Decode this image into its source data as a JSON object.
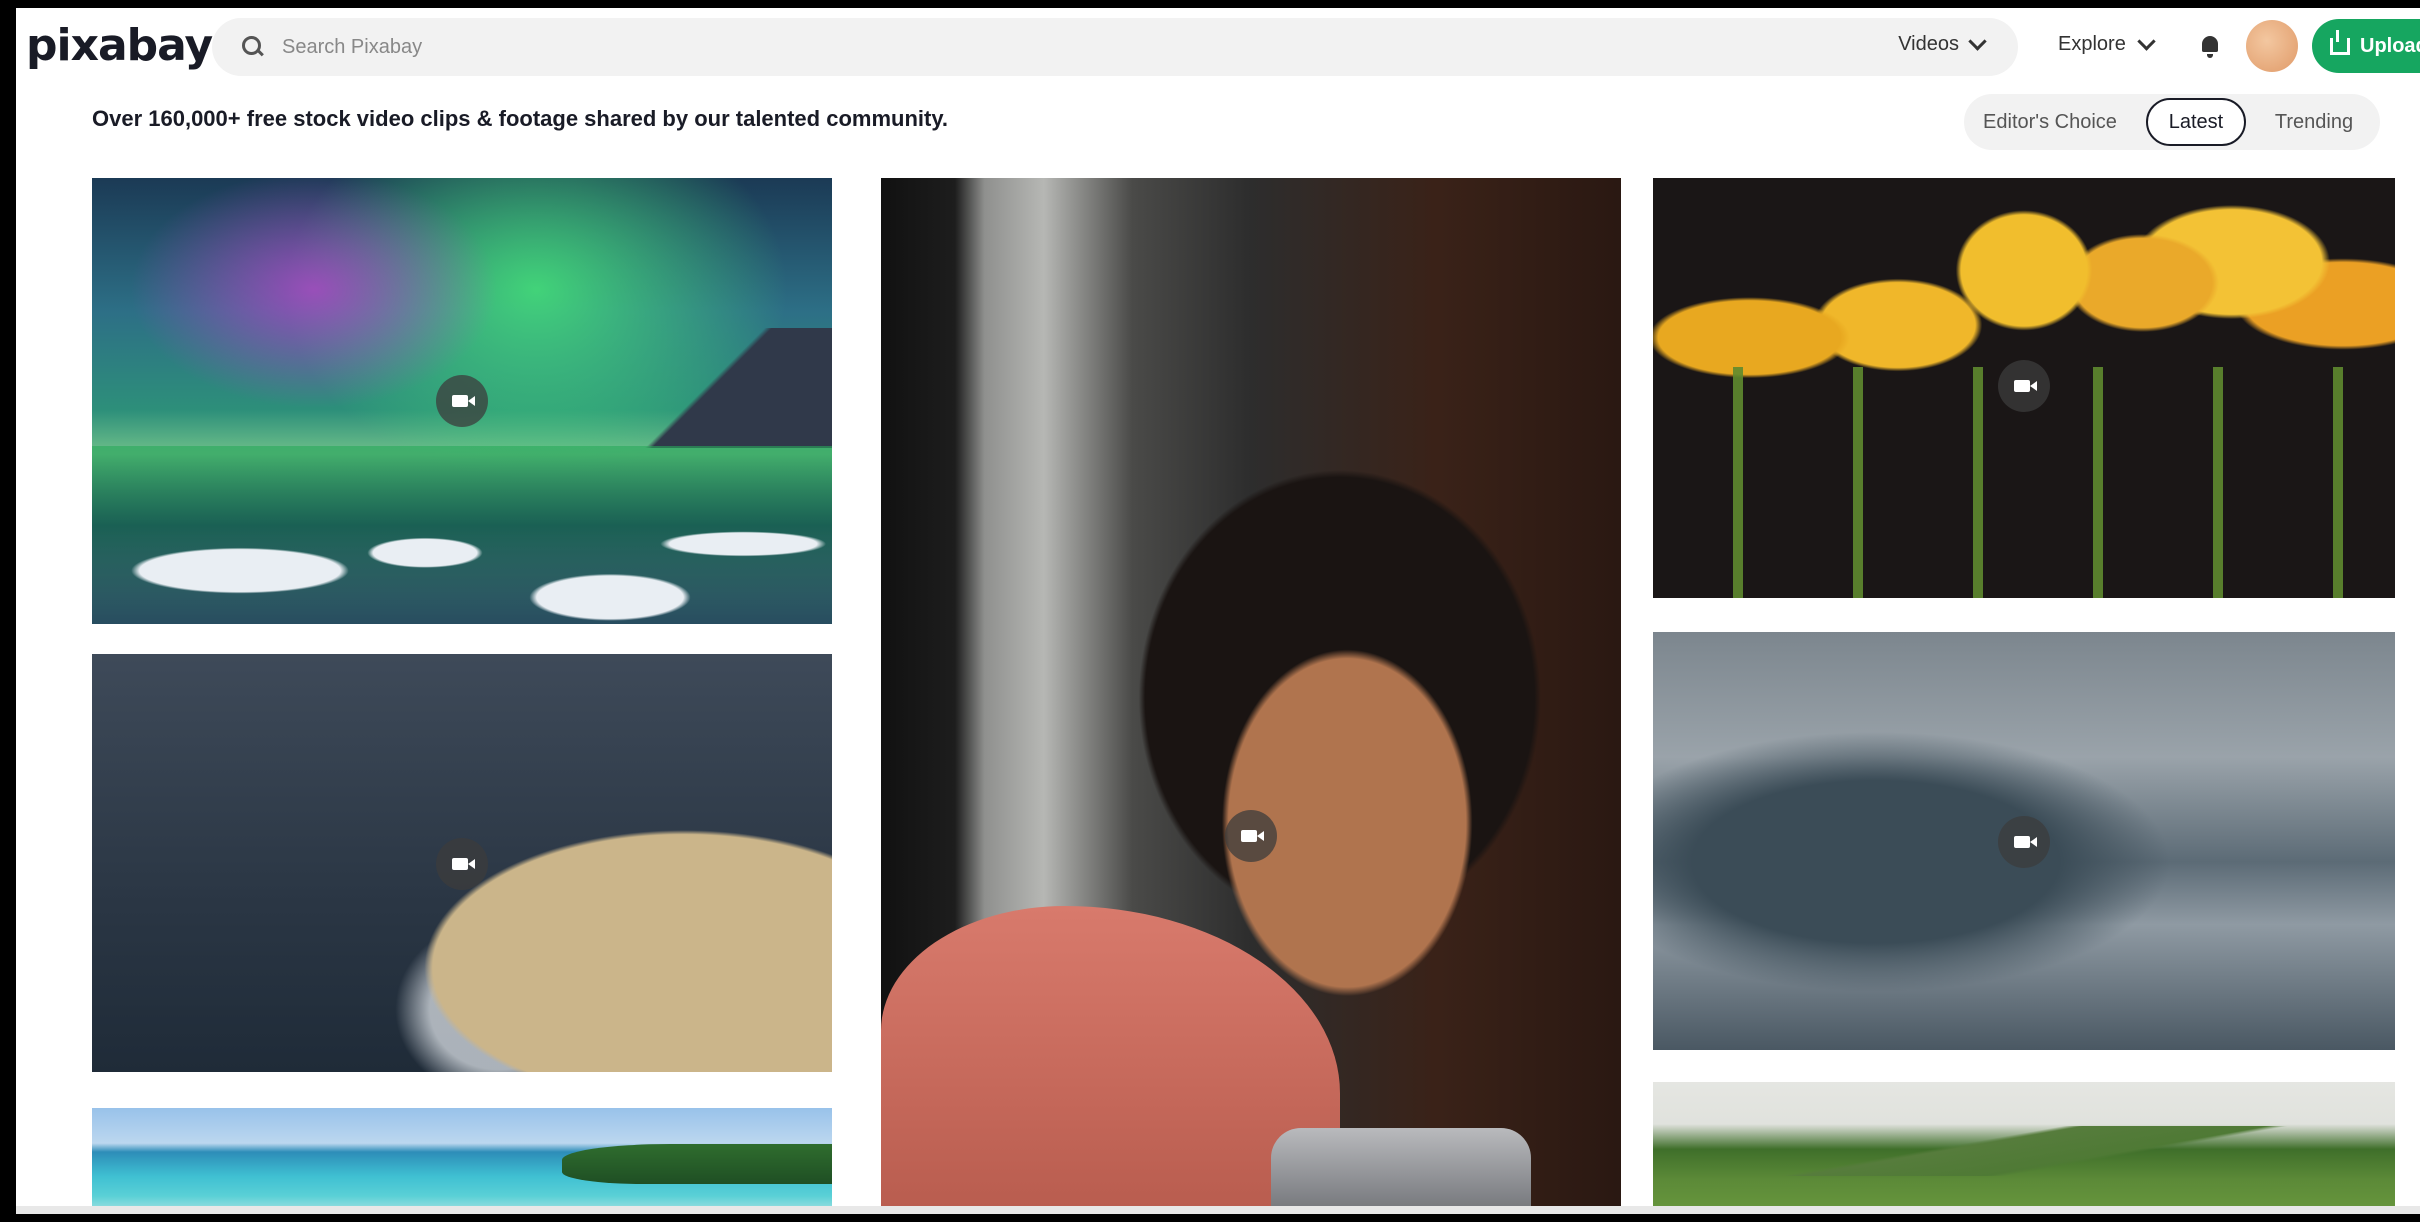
{
  "header": {
    "logo_text": "pixabay",
    "search_placeholder": "Search Pixabay",
    "media_type_label": "Videos",
    "explore_label": "Explore",
    "upload_label": "Upload"
  },
  "tagline": "Over 160,000+ free stock video clips & footage shared by our talented community.",
  "tabs": {
    "editors_choice": "Editor's Choice",
    "latest": "Latest",
    "trending": "Trending",
    "selected": "Latest"
  },
  "icons": {
    "search": "search-icon",
    "chevron": "chevron-down-icon",
    "bell": "bell-icon",
    "upload": "upload-icon",
    "video": "video-camera-icon"
  },
  "colors": {
    "brand_green": "#16a660",
    "text_dark": "#191b26"
  }
}
